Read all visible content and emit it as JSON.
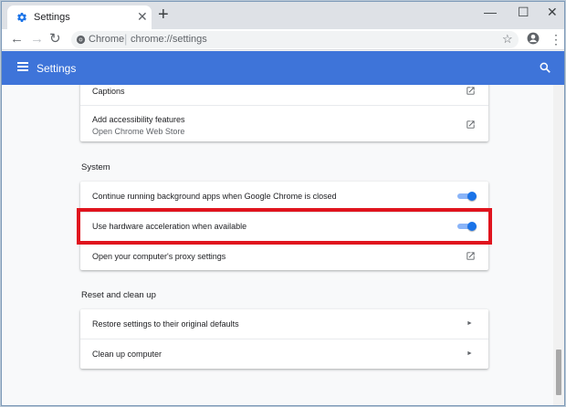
{
  "browser": {
    "tab_title": "Settings",
    "tab_close": "✕",
    "new_tab": "+",
    "window_controls": {
      "minimize": "—",
      "maximize": "☐",
      "close": "✕"
    },
    "nav": {
      "back": "←",
      "forward": "→",
      "reload": "↻"
    },
    "omnibox": {
      "site": "Chrome",
      "separator": "|",
      "url": "chrome://settings"
    },
    "bookmark_star": "☆",
    "menu": "⋮"
  },
  "header": {
    "title": "Settings"
  },
  "accessibility": {
    "rows": [
      {
        "label": "Captions",
        "icon": "open-in-new-icon"
      },
      {
        "label": "Add accessibility features",
        "sublabel": "Open Chrome Web Store",
        "icon": "open-in-new-icon"
      }
    ]
  },
  "system": {
    "title": "System",
    "rows": [
      {
        "label": "Continue running background apps when Google Chrome is closed",
        "enabled": true
      },
      {
        "label": "Use hardware acceleration when available",
        "enabled": true
      },
      {
        "label": "Open your computer's proxy settings",
        "icon": "open-in-new-icon"
      }
    ]
  },
  "reset": {
    "title": "Reset and clean up",
    "rows": [
      {
        "label": "Restore settings to their original defaults",
        "icon": "chevron-right-icon"
      },
      {
        "label": "Clean up computer",
        "icon": "chevron-right-icon"
      }
    ],
    "chevron": "►"
  },
  "colors": {
    "header_blue": "#3e74d9",
    "toggle_blue": "#1a73e8",
    "highlight_red": "#e0141e"
  }
}
